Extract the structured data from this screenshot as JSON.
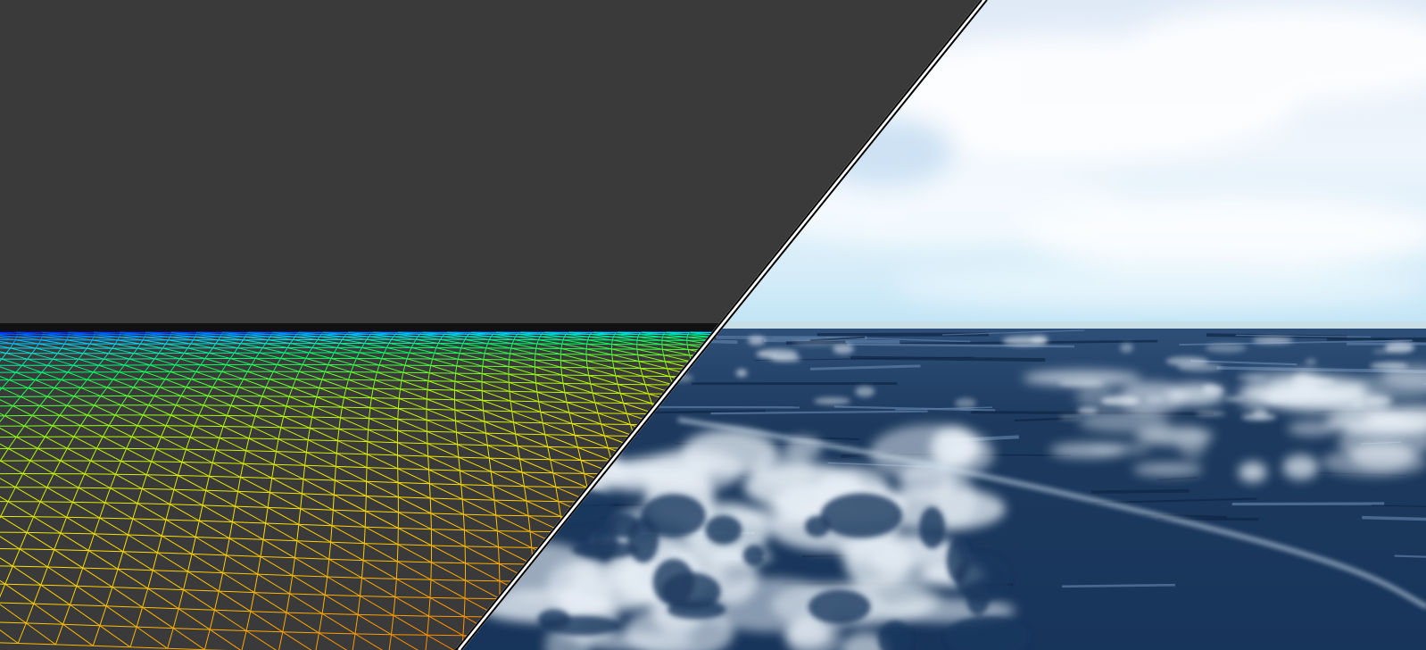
{
  "scene": {
    "left_panel": {
      "kind": "wireframe-terrain",
      "background_color": "#3a3a3a",
      "gradient_colors": [
        "#0000cc",
        "#0050ff",
        "#00d8ff",
        "#00ff60",
        "#b0ff00",
        "#ffe000",
        "#ff8a00",
        "#ff1a00"
      ]
    },
    "right_panel": {
      "kind": "rendered-ocean",
      "sky_colors": [
        "#dfeaf7",
        "#eef5fc",
        "#d4ecf8",
        "#bfe3f5"
      ],
      "water_colors": [
        "#1d3a5e",
        "#2a4d78",
        "#17345a",
        "#e6eef5"
      ]
    },
    "divider_colors": [
      "#ffffff",
      "#000000"
    ]
  }
}
